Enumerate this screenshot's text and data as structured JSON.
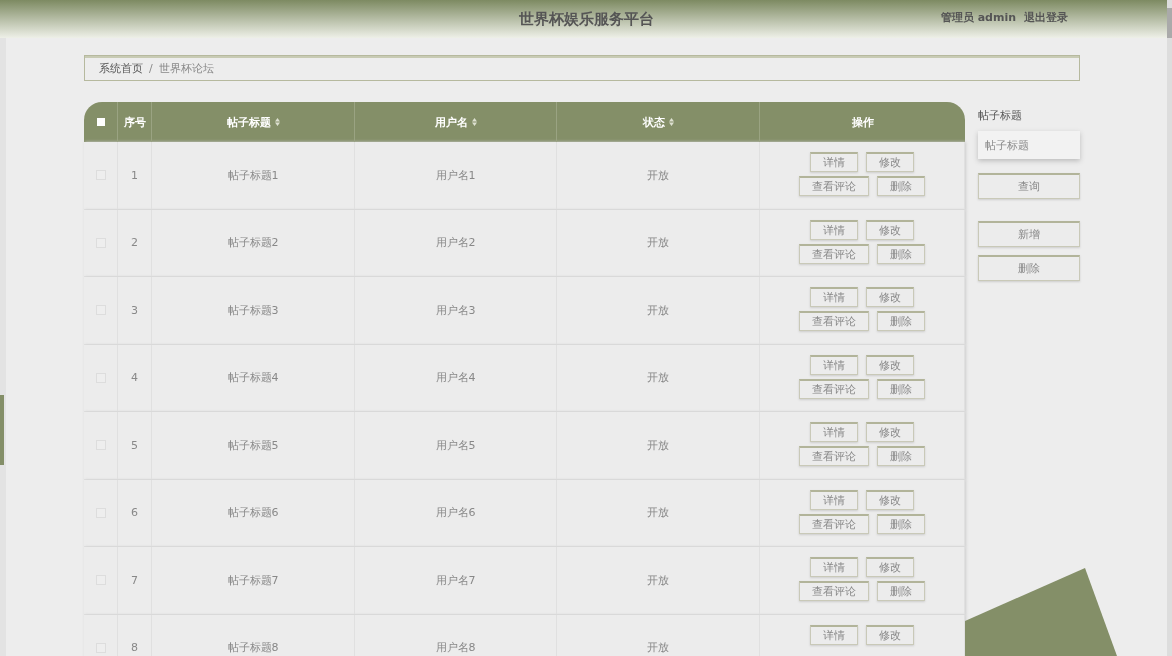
{
  "header": {
    "title": "世界杯娱乐服务平台",
    "user": "管理员 admin",
    "logout": "退出登录"
  },
  "breadcrumb": [
    "系统首页",
    "/",
    "世界杯论坛"
  ],
  "table": {
    "all_checked": false,
    "columns": [
      {
        "label": "序号",
        "sortable": false
      },
      {
        "label": "帖子标题",
        "sortable": true
      },
      {
        "label": "用户名",
        "sortable": true
      },
      {
        "label": "状态",
        "sortable": true
      },
      {
        "label": "操作",
        "sortable": false
      }
    ],
    "rows": [
      {
        "checked": false,
        "index": "1",
        "title": "帖子标题1",
        "user": "用户名1",
        "status": "开放",
        "actions": [
          "详情",
          "修改",
          "查看评论",
          "删除"
        ]
      },
      {
        "checked": false,
        "index": "2",
        "title": "帖子标题2",
        "user": "用户名2",
        "status": "开放",
        "actions": [
          "详情",
          "修改",
          "查看评论",
          "删除"
        ]
      },
      {
        "checked": false,
        "index": "3",
        "title": "帖子标题3",
        "user": "用户名3",
        "status": "开放",
        "actions": [
          "详情",
          "修改",
          "查看评论",
          "删除"
        ]
      },
      {
        "checked": false,
        "index": "4",
        "title": "帖子标题4",
        "user": "用户名4",
        "status": "开放",
        "actions": [
          "详情",
          "修改",
          "查看评论",
          "删除"
        ]
      },
      {
        "checked": false,
        "index": "5",
        "title": "帖子标题5",
        "user": "用户名5",
        "status": "开放",
        "actions": [
          "详情",
          "修改",
          "查看评论",
          "删除"
        ]
      },
      {
        "checked": false,
        "index": "6",
        "title": "帖子标题6",
        "user": "用户名6",
        "status": "开放",
        "actions": [
          "详情",
          "修改",
          "查看评论",
          "删除"
        ]
      },
      {
        "checked": false,
        "index": "7",
        "title": "帖子标题7",
        "user": "用户名7",
        "status": "开放",
        "actions": [
          "详情",
          "修改",
          "查看评论",
          "删除"
        ]
      },
      {
        "checked": false,
        "index": "8",
        "title": "帖子标题8",
        "user": "用户名8",
        "status": "开放",
        "actions": [
          "详情",
          "修改"
        ]
      }
    ]
  },
  "search": {
    "label": "帖子标题",
    "placeholder": "帖子标题",
    "button": "查询"
  },
  "side_buttons": [
    "新增",
    "删除"
  ]
}
